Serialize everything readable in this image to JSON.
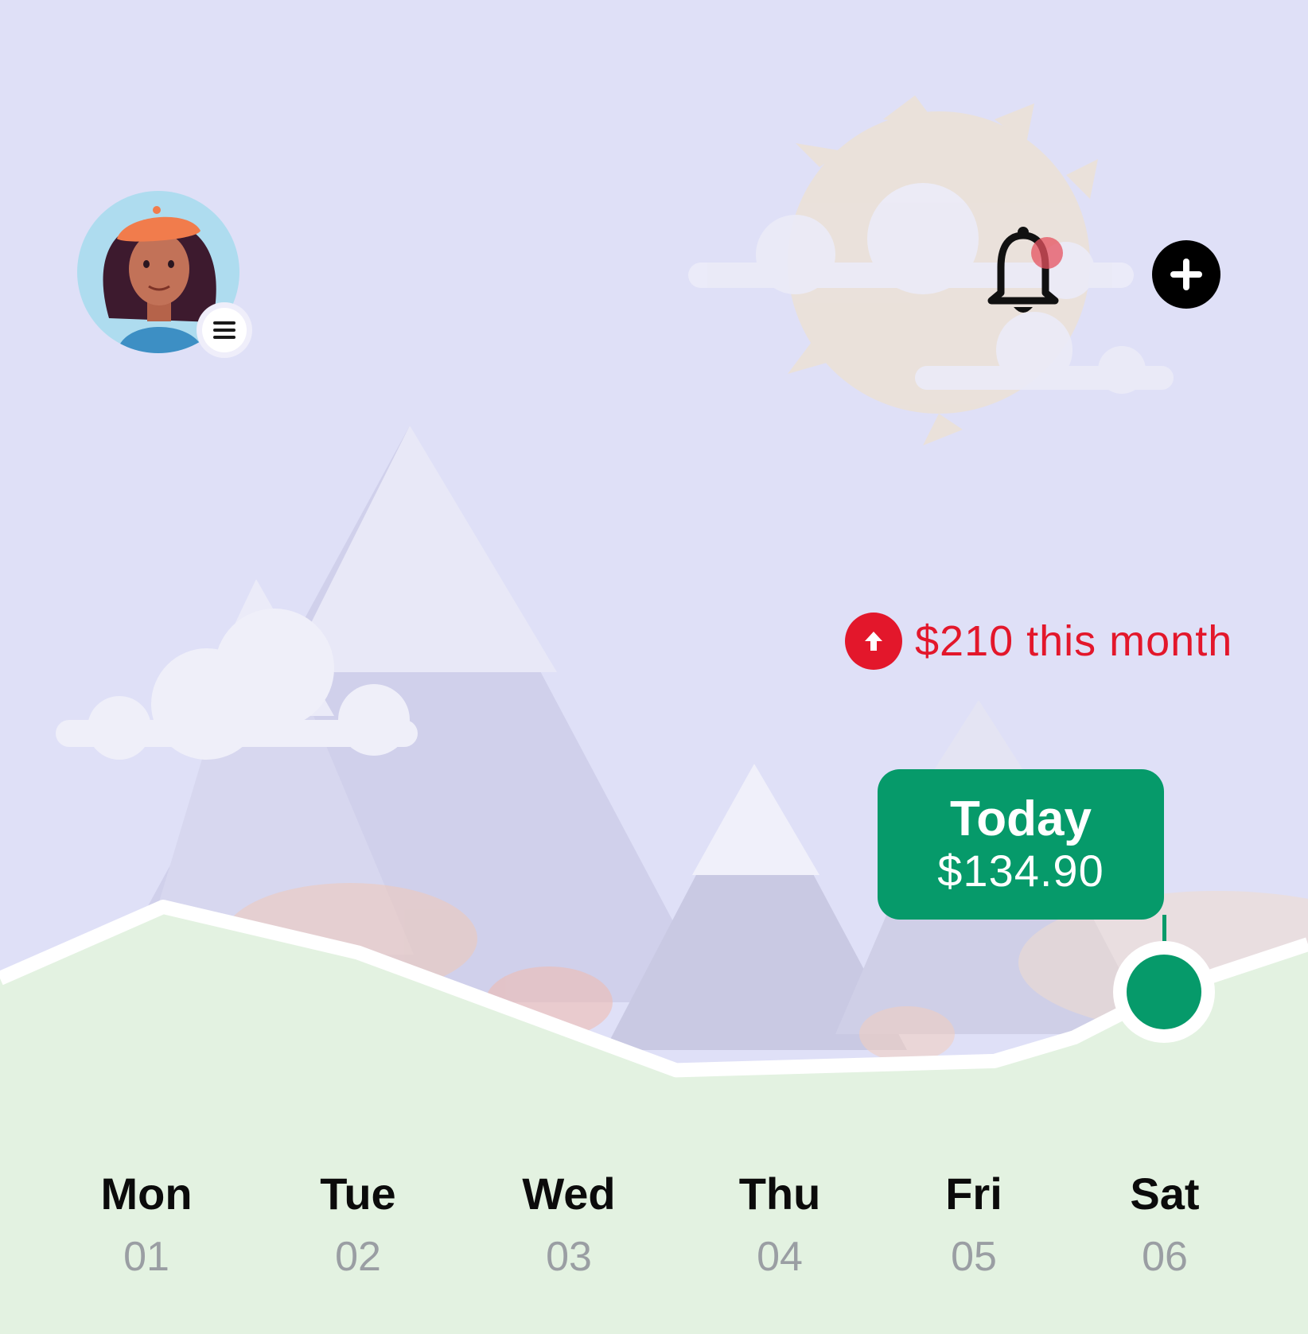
{
  "monthly_change": {
    "amount_text": "$210 this month",
    "direction": "up",
    "color": "#e3172b"
  },
  "tooltip": {
    "title": "Today",
    "value": "$134.90",
    "color": "#069a6a"
  },
  "icons": {
    "avatar": "profile-avatar",
    "menu": "hamburger-menu-icon",
    "notifications": "bell-icon",
    "add": "plus-icon",
    "trend": "arrow-up-icon"
  },
  "chart_data": {
    "type": "area",
    "categories": [
      "Mon",
      "Tue",
      "Wed",
      "Thu",
      "Fri",
      "Sat"
    ],
    "selected_index": 5,
    "series": [
      {
        "values": [
          200,
          165,
          75,
          82,
          100,
          134.9
        ]
      }
    ]
  },
  "days": [
    {
      "name": "Mon",
      "num": "01"
    },
    {
      "name": "Tue",
      "num": "02"
    },
    {
      "name": "Wed",
      "num": "03"
    },
    {
      "name": "Thu",
      "num": "04"
    },
    {
      "name": "Fri",
      "num": "05"
    },
    {
      "name": "Sat",
      "num": "06"
    }
  ],
  "colors": {
    "background": "#dfe0f7",
    "area_fill": "#e3f2e1",
    "accent_green": "#069a6a",
    "alert_red": "#e3172b"
  }
}
